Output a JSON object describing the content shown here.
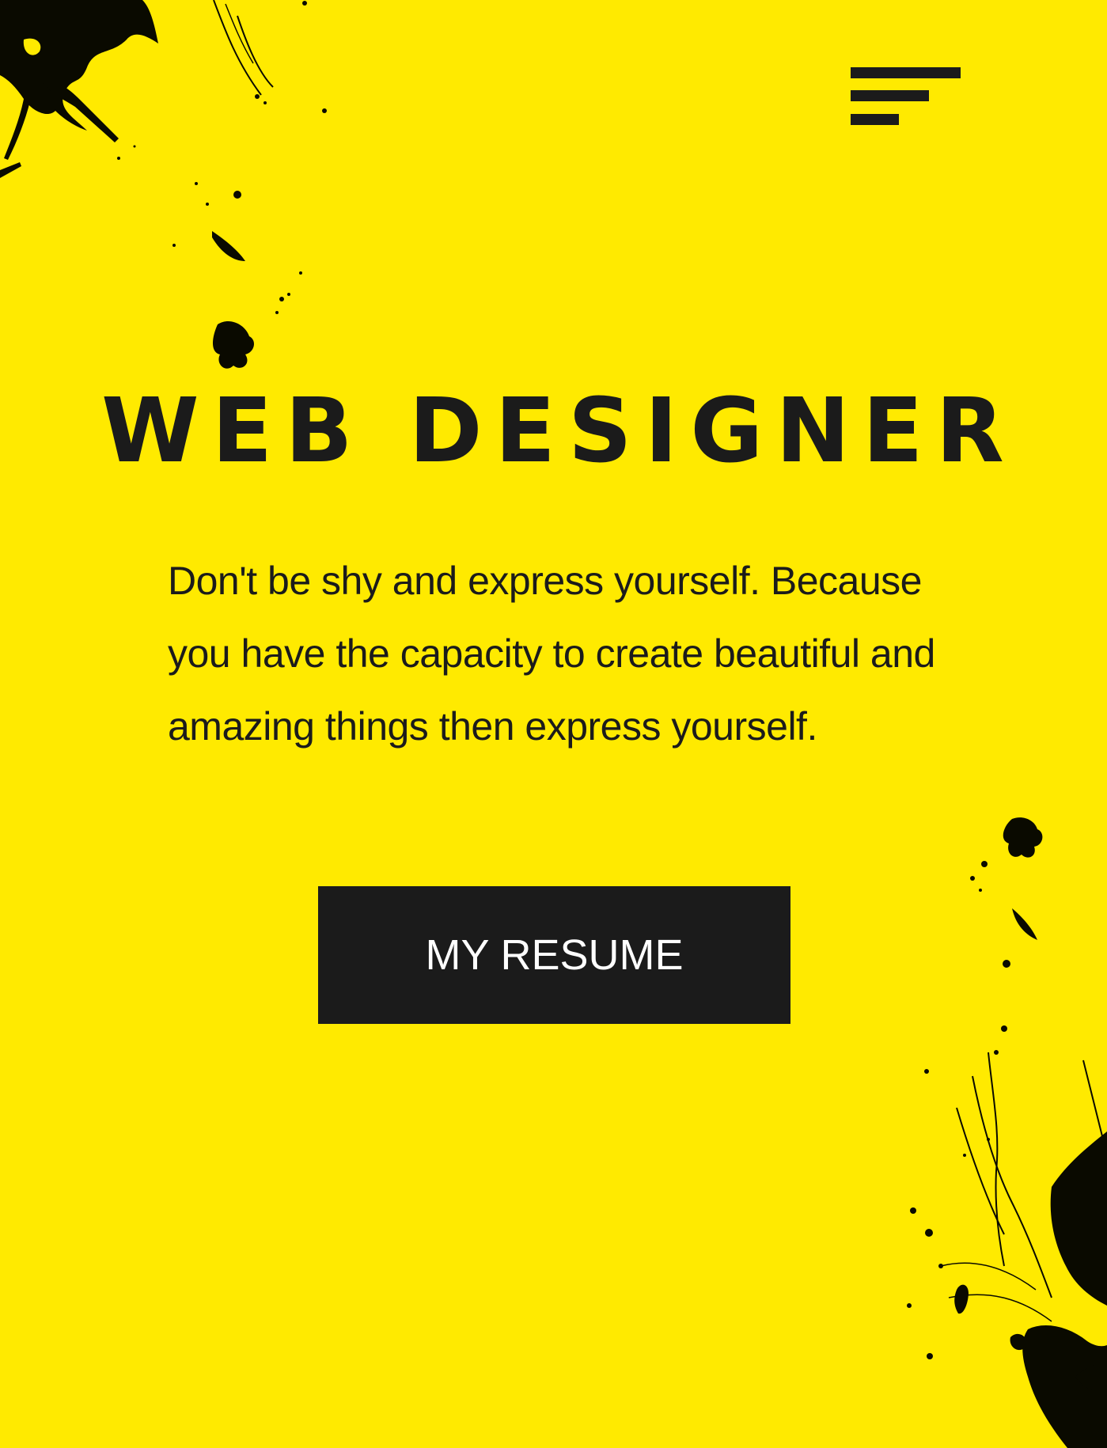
{
  "colors": {
    "background": "#FFEA00",
    "ink": "#1b1b1b",
    "button_text": "#ffffff"
  },
  "header": {
    "menu_icon": "hamburger-menu-icon"
  },
  "hero": {
    "title": "WEB DESIGNER",
    "description": "Don't be shy and express yourself. Because you have the capacity to create beautiful and amazing things then express yourself.",
    "button_label": "MY RESUME"
  },
  "decorations": {
    "top_left": "ink-splatter",
    "bottom_right": "ink-splatter"
  }
}
